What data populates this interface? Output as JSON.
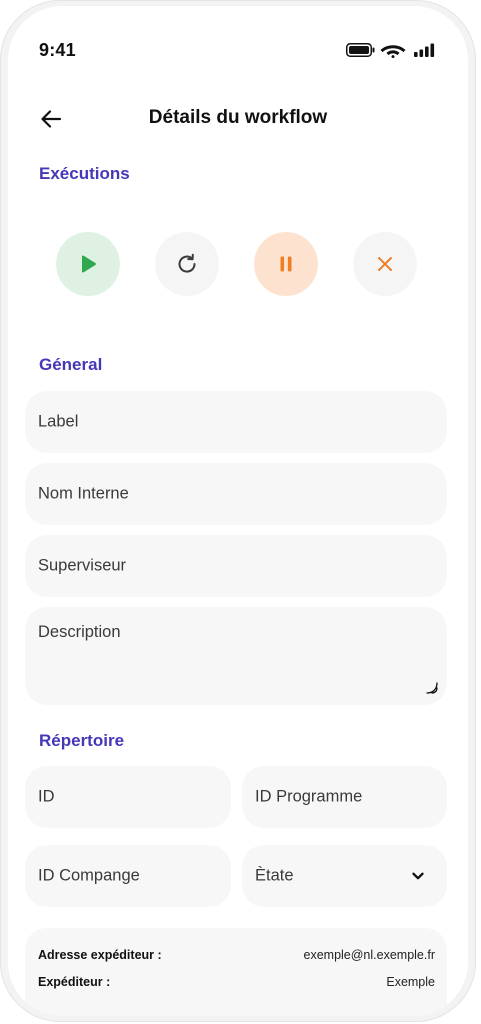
{
  "status_bar": {
    "time": "9:41"
  },
  "header": {
    "title": "Détails du workflow"
  },
  "executions": {
    "title": "Exécutions"
  },
  "general": {
    "title": "Géneral",
    "label_field": "Label",
    "internal_name_field": "Nom Interne",
    "supervisor_field": "Superviseur",
    "description_field": "Description"
  },
  "repository": {
    "title": "Répertoire",
    "id_field": "ID",
    "program_id_field": "ID Programme",
    "company_id_field": "ID Compange",
    "state_field": "Ètate"
  },
  "info": {
    "sender_address_key": "Adresse expéditeur :",
    "sender_address_value": "exemple@nl.exemple.fr",
    "sender_key": "Expéditeur :",
    "sender_value": "Exemple"
  },
  "colors": {
    "accent": "#4438b8",
    "play": "#2fa84f",
    "pause": "#f07e26",
    "stop": "#f07e26"
  }
}
